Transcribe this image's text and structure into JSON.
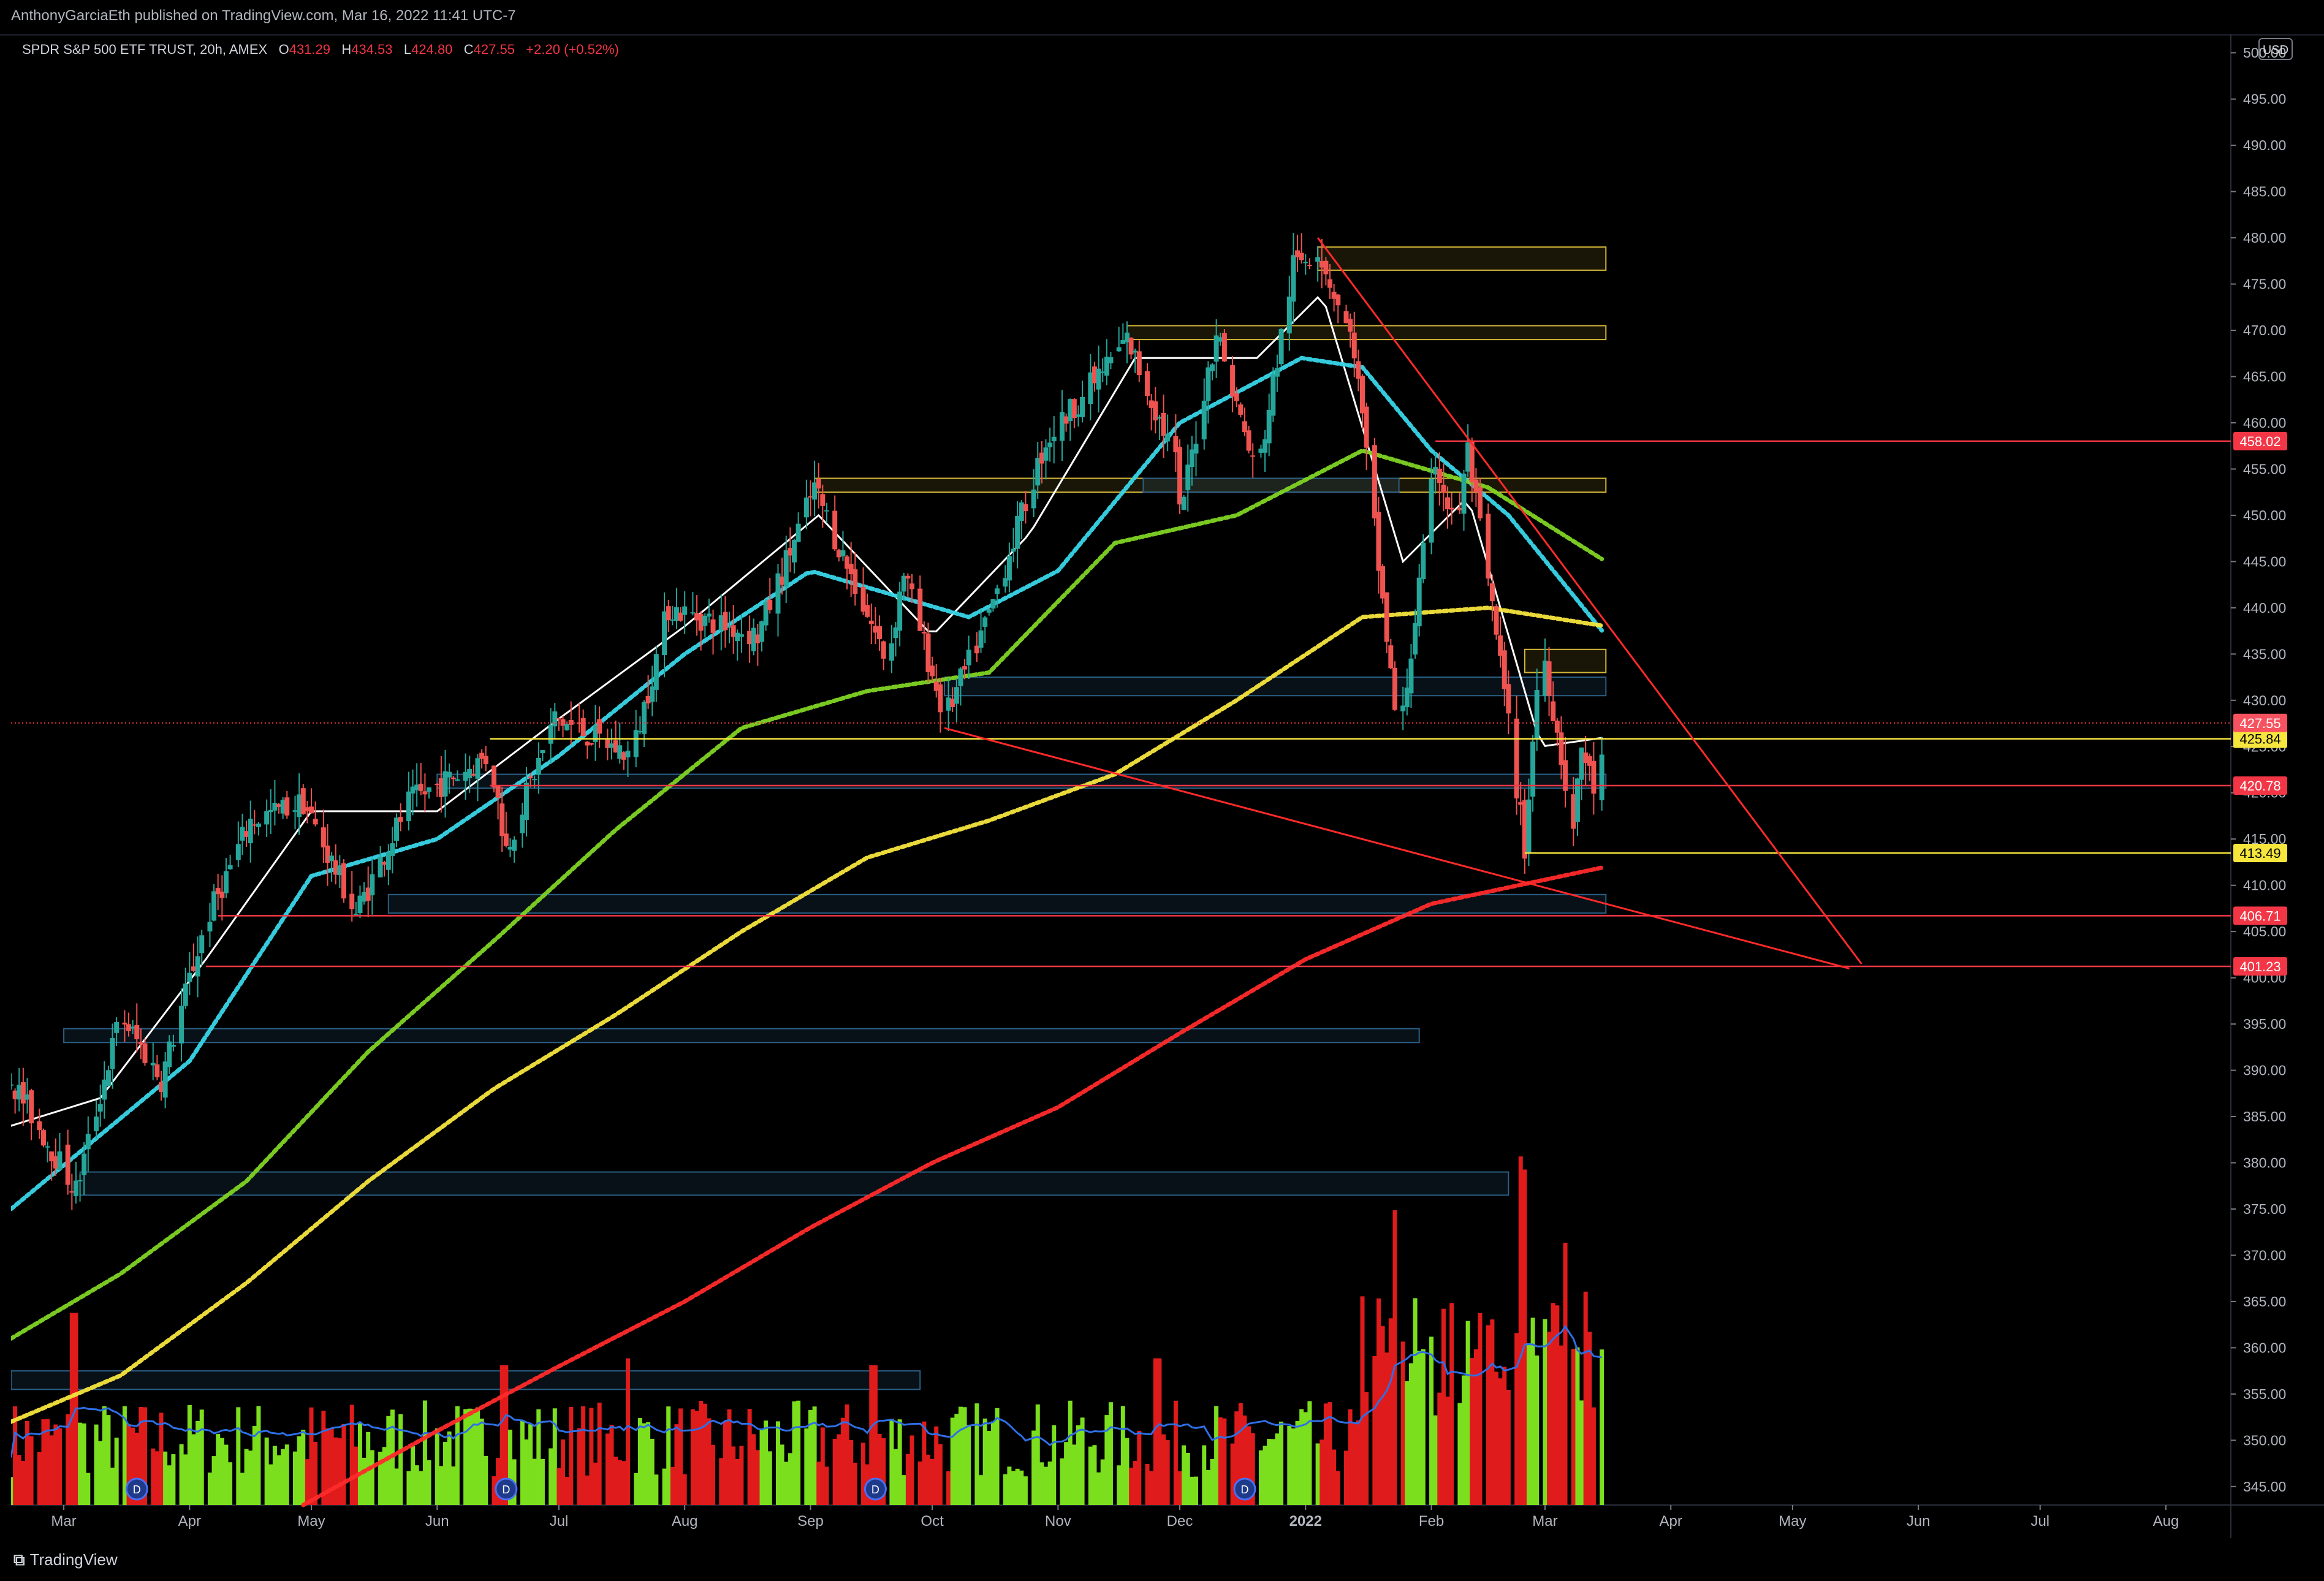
{
  "header": {
    "published": "AnthonyGarciaEth published on TradingView.com, Mar 16, 2022 11:41 UTC-7"
  },
  "legend": {
    "symbol": "SPDR S&P 500 ETF TRUST, 20h, AMEX",
    "open_label": "O",
    "open": "431.29",
    "high_label": "H",
    "high": "434.53",
    "low_label": "L",
    "low": "424.80",
    "close_label": "C",
    "close": "427.55",
    "change": "+2.20 (+0.52%)"
  },
  "currency": "USD",
  "brand": {
    "name": "TradingView",
    "icon": "tradingview-logo-icon"
  },
  "colors": {
    "background": "#000000",
    "up": "#26a69a",
    "down": "#ef5350",
    "volume_up": "#7cdf1e",
    "volume_down": "#e01b1b",
    "volume_ma": "#2f6fe6",
    "ema_fast": "#ffffff",
    "ema_cyan": "#38d6e8",
    "ema_green": "#7fd424",
    "ema_yellow": "#f5e53d",
    "ema_red": "#ff2a2a",
    "trendline": "#ff2a2a",
    "zone_yellow": "#d4b83a",
    "zone_blue": "#2b5f86"
  },
  "chart_data": {
    "type": "candlestick",
    "title": "SPDR S&P 500 ETF TRUST, 20h, AMEX",
    "timeframe": "20h",
    "y_axis": {
      "range": [
        343,
        502
      ],
      "ticks": [
        345,
        350,
        355,
        360,
        365,
        370,
        375,
        380,
        385,
        390,
        395,
        400,
        405,
        410,
        415,
        420,
        425,
        430,
        435,
        440,
        445,
        450,
        455,
        460,
        465,
        470,
        475,
        480,
        485,
        490,
        495,
        500
      ],
      "tick_labels": [
        "345.00",
        "350.00",
        "355.00",
        "360.00",
        "365.00",
        "370.00",
        "375.00",
        "380.00",
        "385.00",
        "390.00",
        "395.00",
        "400.00",
        "405.00",
        "410.00",
        "415.00",
        "420.00",
        "425.00",
        "430.00",
        "435.00",
        "440.00",
        "445.00",
        "450.00",
        "455.00",
        "460.00",
        "465.00",
        "470.00",
        "475.00",
        "480.00",
        "485.00",
        "490.00",
        "495.00",
        "500.00"
      ]
    },
    "x_axis": {
      "range": [
        "2021-02-16",
        "2022-08-17"
      ],
      "ticks": [
        {
          "date": "2021-03-01",
          "label": "Mar"
        },
        {
          "date": "2021-04-01",
          "label": "Apr"
        },
        {
          "date": "2021-05-01",
          "label": "May"
        },
        {
          "date": "2021-06-01",
          "label": "Jun"
        },
        {
          "date": "2021-07-01",
          "label": "Jul"
        },
        {
          "date": "2021-08-01",
          "label": "Aug"
        },
        {
          "date": "2021-09-01",
          "label": "Sep"
        },
        {
          "date": "2021-10-01",
          "label": "Oct"
        },
        {
          "date": "2021-11-01",
          "label": "Nov"
        },
        {
          "date": "2021-12-01",
          "label": "Dec"
        },
        {
          "date": "2022-01-01",
          "label": "2022",
          "bold": true
        },
        {
          "date": "2022-02-01",
          "label": "Feb"
        },
        {
          "date": "2022-03-01",
          "label": "Mar"
        },
        {
          "date": "2022-04-01",
          "label": "Apr"
        },
        {
          "date": "2022-05-01",
          "label": "May"
        },
        {
          "date": "2022-06-01",
          "label": "Jun"
        },
        {
          "date": "2022-07-01",
          "label": "Jul"
        },
        {
          "date": "2022-08-01",
          "label": "Aug"
        }
      ]
    },
    "price_path": [
      [
        "2021-02-16",
        389
      ],
      [
        "2021-03-04",
        377
      ],
      [
        "2021-03-15",
        396
      ],
      [
        "2021-03-25",
        389
      ],
      [
        "2021-04-05",
        406
      ],
      [
        "2021-04-16",
        417
      ],
      [
        "2021-04-29",
        419
      ],
      [
        "2021-05-12",
        407
      ],
      [
        "2021-05-25",
        419
      ],
      [
        "2021-06-14",
        424
      ],
      [
        "2021-06-18",
        414
      ],
      [
        "2021-06-30",
        428
      ],
      [
        "2021-07-19",
        424
      ],
      [
        "2021-07-28",
        440
      ],
      [
        "2021-08-19",
        437
      ],
      [
        "2021-09-02",
        453
      ],
      [
        "2021-09-20",
        434
      ],
      [
        "2021-09-24",
        444
      ],
      [
        "2021-10-04",
        428
      ],
      [
        "2021-10-14",
        438
      ],
      [
        "2021-10-29",
        458
      ],
      [
        "2021-11-18",
        469
      ],
      [
        "2021-11-30",
        456
      ],
      [
        "2021-12-01",
        450
      ],
      [
        "2021-12-10",
        470
      ],
      [
        "2021-12-20",
        454
      ],
      [
        "2021-12-29",
        477
      ],
      [
        "2022-01-04",
        479
      ],
      [
        "2022-01-13",
        468
      ],
      [
        "2022-01-24",
        425
      ],
      [
        "2022-02-02",
        456
      ],
      [
        "2022-02-07",
        448
      ],
      [
        "2022-02-10",
        457
      ],
      [
        "2022-02-18",
        434
      ],
      [
        "2022-02-24",
        414
      ],
      [
        "2022-02-28",
        437
      ],
      [
        "2022-03-08",
        416
      ],
      [
        "2022-03-10",
        425
      ],
      [
        "2022-03-14",
        419
      ],
      [
        "2022-03-16",
        427.55
      ]
    ],
    "current_price": 427.55,
    "ema_lines": [
      {
        "color_key": "ema_fast",
        "points": [
          [
            "2021-02-16",
            384
          ],
          [
            "2021-03-10",
            387
          ],
          [
            "2021-04-05",
            402
          ],
          [
            "2021-05-01",
            418
          ],
          [
            "2021-06-01",
            418
          ],
          [
            "2021-07-01",
            428
          ],
          [
            "2021-08-01",
            438
          ],
          [
            "2021-09-03",
            450
          ],
          [
            "2021-10-01",
            437
          ],
          [
            "2021-10-25",
            448
          ],
          [
            "2021-11-20",
            467
          ],
          [
            "2021-12-20",
            467
          ],
          [
            "2022-01-05",
            474
          ],
          [
            "2022-01-25",
            445
          ],
          [
            "2022-02-10",
            452
          ],
          [
            "2022-02-28",
            425
          ],
          [
            "2022-03-16",
            426
          ]
        ]
      },
      {
        "color_key": "ema_cyan",
        "points": [
          [
            "2021-02-16",
            375
          ],
          [
            "2021-03-10",
            383
          ],
          [
            "2021-04-01",
            391
          ],
          [
            "2021-05-01",
            411
          ],
          [
            "2021-06-01",
            415
          ],
          [
            "2021-07-01",
            424
          ],
          [
            "2021-08-01",
            435
          ],
          [
            "2021-09-01",
            444
          ],
          [
            "2021-10-10",
            439
          ],
          [
            "2021-11-01",
            444
          ],
          [
            "2021-12-01",
            460
          ],
          [
            "2021-12-31",
            467
          ],
          [
            "2022-01-15",
            466
          ],
          [
            "2022-02-01",
            457
          ],
          [
            "2022-02-20",
            450
          ],
          [
            "2022-03-16",
            437
          ]
        ]
      },
      {
        "color_key": "ema_green",
        "points": [
          [
            "2021-02-16",
            361
          ],
          [
            "2021-03-15",
            368
          ],
          [
            "2021-04-15",
            378
          ],
          [
            "2021-05-15",
            392
          ],
          [
            "2021-06-15",
            404
          ],
          [
            "2021-07-15",
            416
          ],
          [
            "2021-08-15",
            427
          ],
          [
            "2021-09-15",
            431
          ],
          [
            "2021-10-15",
            433
          ],
          [
            "2021-11-15",
            447
          ],
          [
            "2021-12-15",
            450
          ],
          [
            "2022-01-15",
            457
          ],
          [
            "2022-02-15",
            453
          ],
          [
            "2022-03-16",
            445
          ]
        ]
      },
      {
        "color_key": "ema_yellow",
        "points": [
          [
            "2021-02-16",
            352
          ],
          [
            "2021-03-15",
            357
          ],
          [
            "2021-04-15",
            367
          ],
          [
            "2021-05-15",
            378
          ],
          [
            "2021-06-15",
            388
          ],
          [
            "2021-07-15",
            396
          ],
          [
            "2021-08-15",
            405
          ],
          [
            "2021-09-15",
            413
          ],
          [
            "2021-10-15",
            417
          ],
          [
            "2021-11-15",
            422
          ],
          [
            "2021-12-15",
            430
          ],
          [
            "2022-01-15",
            439
          ],
          [
            "2022-02-15",
            440
          ],
          [
            "2022-03-16",
            438
          ]
        ]
      },
      {
        "color_key": "ema_red",
        "points": [
          [
            "2021-04-29",
            343
          ],
          [
            "2021-06-01",
            351
          ],
          [
            "2021-07-01",
            358
          ],
          [
            "2021-08-01",
            365
          ],
          [
            "2021-09-01",
            373
          ],
          [
            "2021-10-01",
            380
          ],
          [
            "2021-11-01",
            386
          ],
          [
            "2021-12-01",
            394
          ],
          [
            "2022-01-01",
            402
          ],
          [
            "2022-02-01",
            408
          ],
          [
            "2022-03-16",
            412
          ]
        ]
      }
    ],
    "trendlines": [
      {
        "from": [
          "2022-01-04",
          480
        ],
        "to": [
          "2022-05-18",
          401.5
        ]
      },
      {
        "from": [
          "2021-10-04",
          427
        ],
        "to": [
          "2022-05-15",
          401
        ]
      }
    ],
    "horizontal_levels": [
      {
        "price": 458.02,
        "label": "458.02",
        "color": "#f23645",
        "start": "2022-02-02"
      },
      {
        "price": 425.84,
        "label": "425.84",
        "color": "#f5e53d",
        "start": "2021-06-14"
      },
      {
        "price": 420.78,
        "label": "420.78",
        "color": "#f23645",
        "start": "2021-06-14"
      },
      {
        "price": 413.49,
        "label": "413.49",
        "color": "#f5e53d",
        "start": "2022-02-24"
      },
      {
        "price": 406.71,
        "label": "406.71",
        "color": "#f23645",
        "start": "2021-04-08"
      },
      {
        "price": 401.23,
        "label": "401.23",
        "color": "#f23645",
        "start": "2021-04-05"
      }
    ],
    "current_price_label": "427.55",
    "zones": [
      {
        "kind": "zone_yellow",
        "from": "2022-01-04",
        "to": "2022-03-16",
        "high": 479,
        "low": 476.5
      },
      {
        "kind": "zone_yellow",
        "from": "2021-11-18",
        "to": "2022-03-16",
        "high": 470.5,
        "low": 469
      },
      {
        "kind": "zone_yellow",
        "from": "2021-09-02",
        "to": "2022-03-16",
        "high": 454,
        "low": 452.5
      },
      {
        "kind": "zone_yellow",
        "from": "2022-02-24",
        "to": "2022-03-16",
        "high": 435.5,
        "low": 433
      },
      {
        "kind": "zone_blue",
        "from": "2021-11-22",
        "to": "2022-01-24",
        "high": 454,
        "low": 452.5
      },
      {
        "kind": "zone_blue",
        "from": "2021-10-04",
        "to": "2022-03-16",
        "high": 432.5,
        "low": 430.5
      },
      {
        "kind": "zone_blue",
        "from": "2021-06-01",
        "to": "2022-03-16",
        "high": 422,
        "low": 420.5
      },
      {
        "kind": "zone_blue",
        "from": "2021-05-20",
        "to": "2022-03-16",
        "high": 409,
        "low": 407
      },
      {
        "kind": "zone_blue",
        "from": "2021-03-01",
        "to": "2022-01-29",
        "high": 394.5,
        "low": 393
      },
      {
        "kind": "zone_blue",
        "from": "2021-03-05",
        "to": "2022-02-20",
        "high": 379,
        "low": 376.5
      },
      {
        "kind": "zone_blue",
        "from": "2021-02-16",
        "to": "2021-09-28",
        "high": 357.5,
        "low": 355.5
      }
    ],
    "volume": {
      "y_range_max_units": 100,
      "note": "volume bars drawn in lower pane, relative heights only",
      "peaks": [
        {
          "date": "2021-03-04",
          "value": 55,
          "dir": "down"
        },
        {
          "date": "2021-06-18",
          "value": 40,
          "dir": "down"
        },
        {
          "date": "2021-07-19",
          "value": 42,
          "dir": "down"
        },
        {
          "date": "2021-09-17",
          "value": 40,
          "dir": "down"
        },
        {
          "date": "2021-11-26",
          "value": 42,
          "dir": "down"
        },
        {
          "date": "2022-01-24",
          "value": 64,
          "dir": "down"
        },
        {
          "date": "2022-02-24",
          "value": 80,
          "dir": "up"
        },
        {
          "date": "2022-03-07",
          "value": 57,
          "dir": "down"
        }
      ],
      "dividend_markers": [
        "2021-03-19",
        "2021-06-18",
        "2021-09-17",
        "2021-12-17"
      ],
      "dividend_marker_label": "D"
    }
  }
}
